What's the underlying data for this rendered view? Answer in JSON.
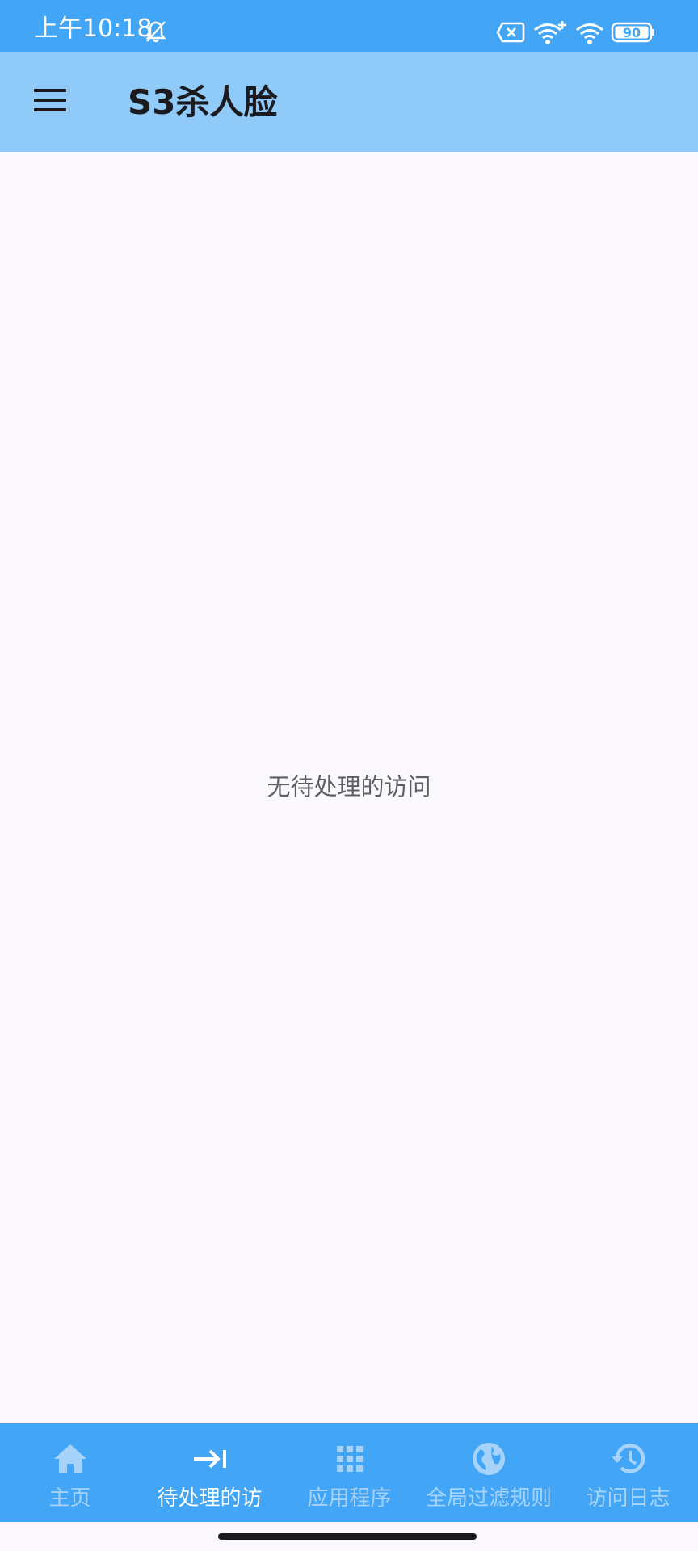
{
  "status_bar": {
    "time": "上午10:18",
    "battery": "90",
    "icons": [
      "bell-off-icon",
      "sim-off-icon",
      "wifi-plus-icon",
      "wifi-icon",
      "battery-icon"
    ]
  },
  "app_bar": {
    "title": "S3杀人脸",
    "menu_icon": "menu-icon"
  },
  "main": {
    "empty_message": "无待处理的访问"
  },
  "bottom_nav": {
    "active_index": 1,
    "items": [
      {
        "label": "主页",
        "icon": "home-icon"
      },
      {
        "label": "待处理的访",
        "icon": "arrow-right-to-line-icon"
      },
      {
        "label": "应用程序",
        "icon": "apps-grid-icon"
      },
      {
        "label": "全局过滤规则",
        "icon": "globe-icon"
      },
      {
        "label": "访问日志",
        "icon": "history-icon"
      }
    ]
  },
  "colors": {
    "status_bar": "#42a5f5",
    "app_bar": "#90caf9",
    "background": "#fbf8fd",
    "nav_inactive": "#a7d3fa",
    "nav_active": "#ffffff"
  }
}
